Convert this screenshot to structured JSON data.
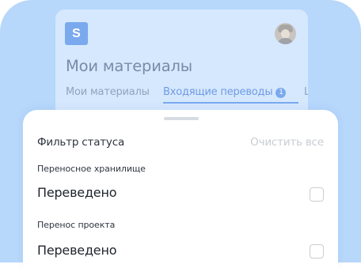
{
  "app": {
    "logo_letter": "S",
    "title": "Мои материалы",
    "tabs": [
      {
        "label": "Мои материалы"
      },
      {
        "label": "Входящие переводы",
        "badge": "1"
      },
      {
        "label": "L"
      }
    ],
    "accent_color": "#7aa9ee"
  },
  "filter_sheet": {
    "title": "Фильтр статуса",
    "clear_all": "Очистить все",
    "groups": [
      {
        "label": "Переносное хранилище",
        "option": "Переведено",
        "checked": false
      },
      {
        "label": "Перенос проекта",
        "option": "Переведено",
        "checked": false
      }
    ]
  },
  "icons": {
    "avatar": "user-avatar",
    "handle": "drag-handle",
    "badge": "count-badge"
  }
}
